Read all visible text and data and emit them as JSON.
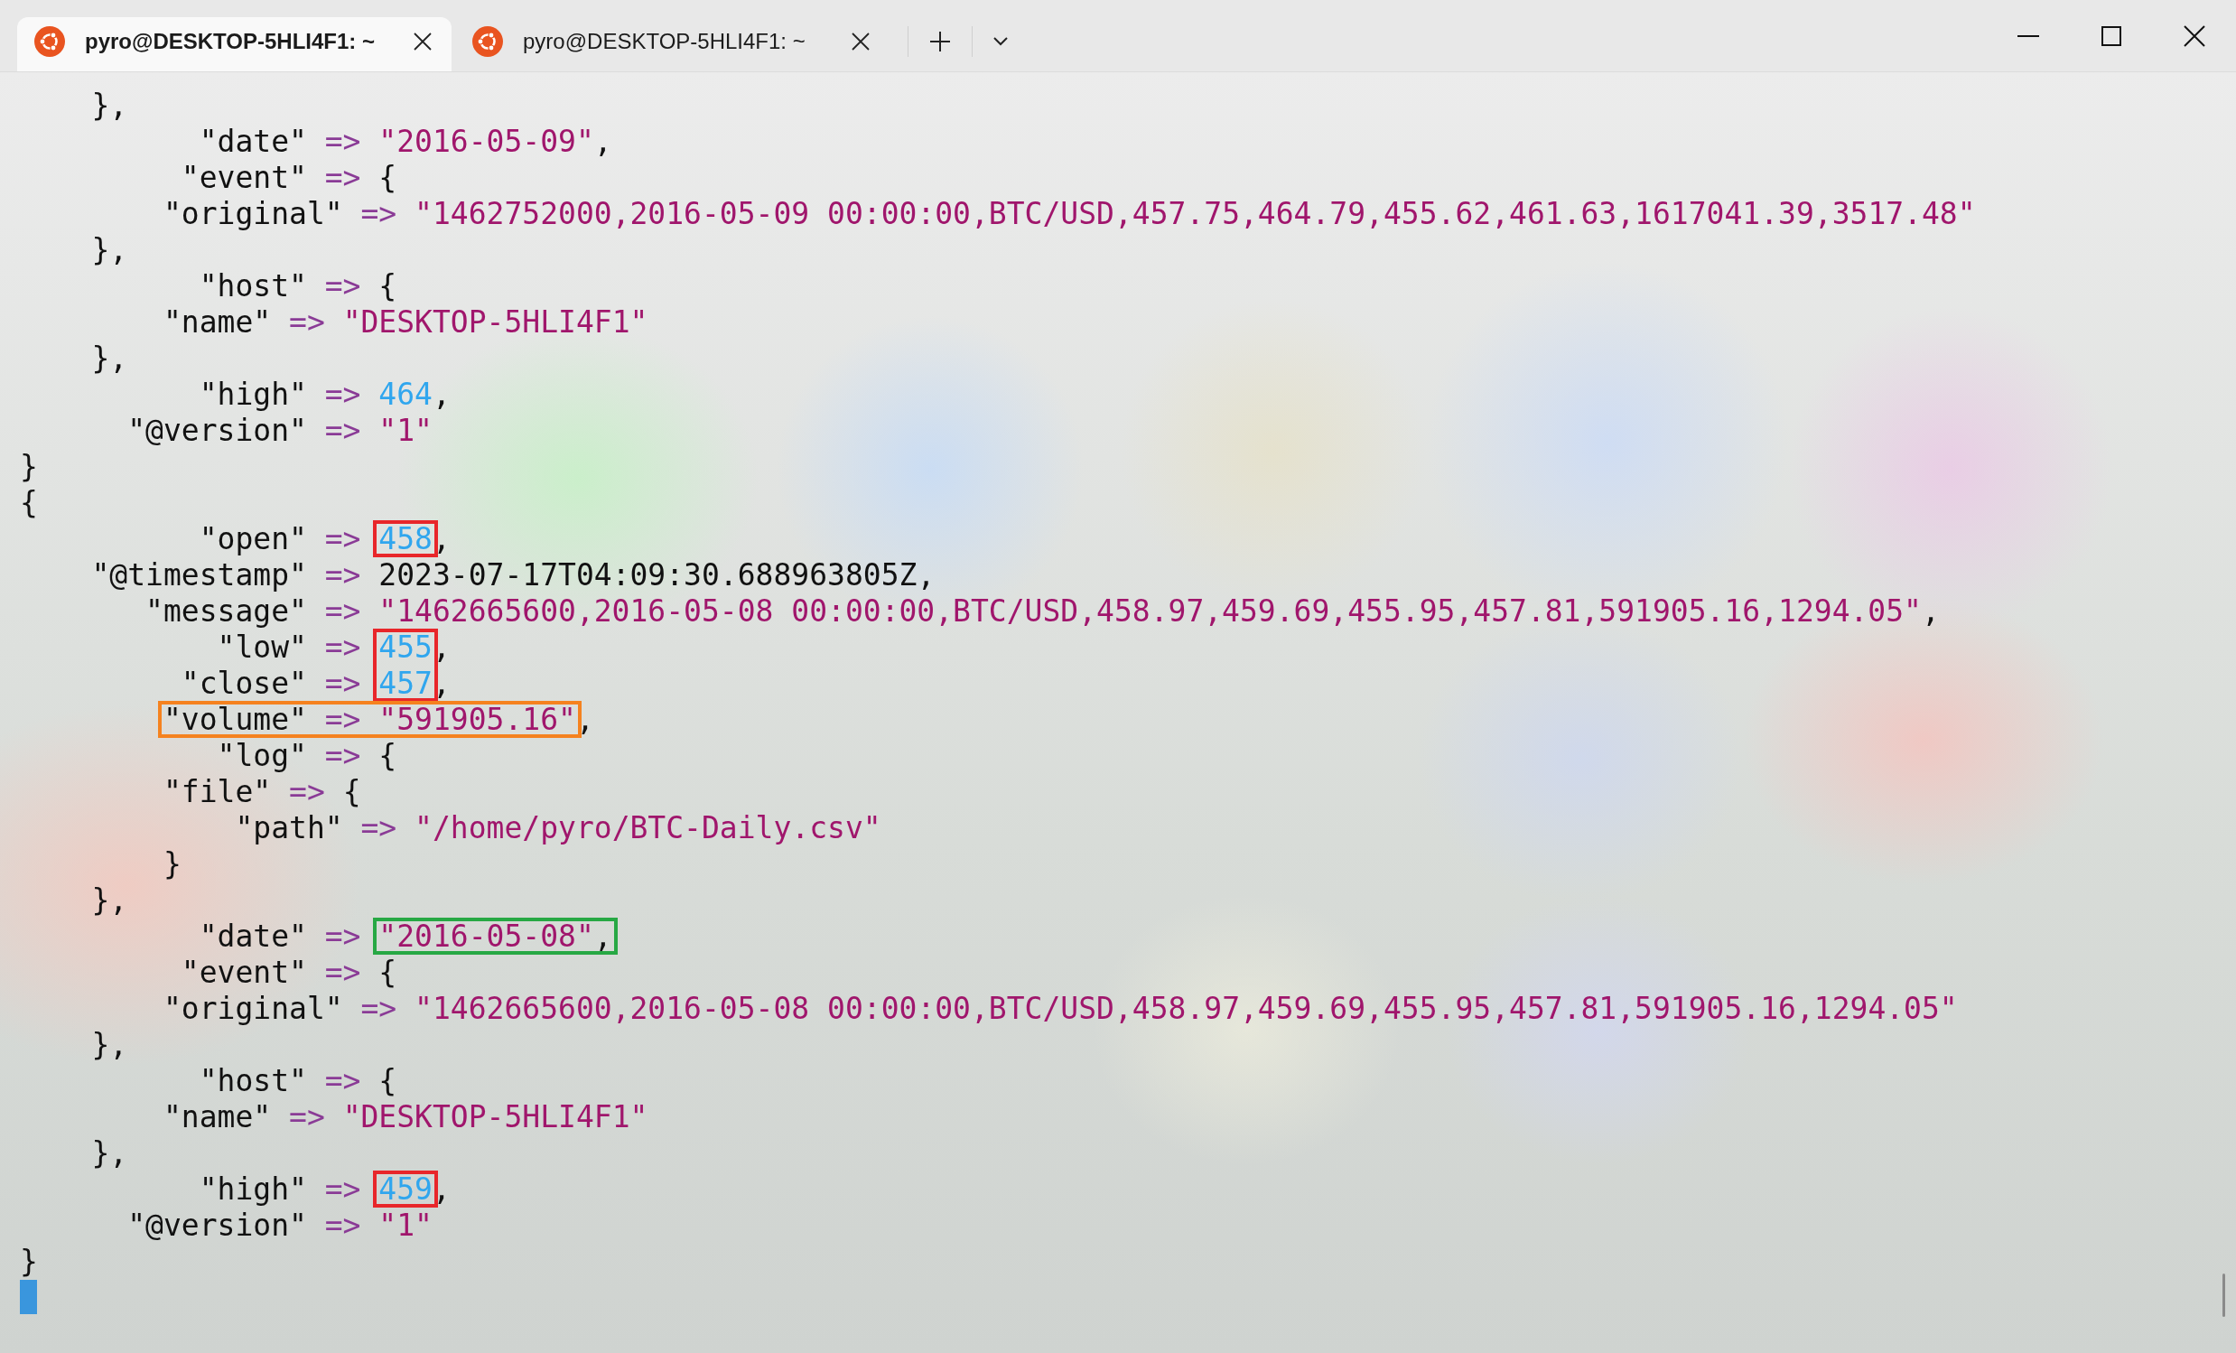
{
  "tabs": [
    {
      "title": "pyro@DESKTOP-5HLI4F1: ~",
      "selected": true
    },
    {
      "title": "pyro@DESKTOP-5HLI4F1: ~",
      "selected": false
    }
  ],
  "terminal": {
    "lines": [
      {
        "tokens": [
          {
            "kind": "plain",
            "text": "},"
          }
        ]
      },
      {
        "tokens": [
          {
            "kind": "key",
            "text": "\"date\""
          },
          {
            "kind": "arrow",
            "text": "=>"
          },
          {
            "kind": "string",
            "text": "\"2016-05-09\""
          },
          {
            "kind": "punct",
            "text": ","
          }
        ]
      },
      {
        "tokens": [
          {
            "kind": "key",
            "text": "\"event\""
          },
          {
            "kind": "arrow",
            "text": "=>"
          },
          {
            "kind": "plain",
            "text": "{"
          }
        ]
      },
      {
        "tokens": [
          {
            "kind": "key",
            "text": "\"original\""
          },
          {
            "kind": "arrow",
            "text": "=>"
          },
          {
            "kind": "string",
            "text": "\"1462752000,2016-05-09 00:00:00,BTC/USD,457.75,464.79,455.62,461.63,1617041.39,3517.48\""
          }
        ]
      },
      {
        "tokens": [
          {
            "kind": "plain",
            "text": "},"
          }
        ]
      },
      {
        "tokens": [
          {
            "kind": "key",
            "text": "\"host\""
          },
          {
            "kind": "arrow",
            "text": "=>"
          },
          {
            "kind": "plain",
            "text": "{"
          }
        ]
      },
      {
        "tokens": [
          {
            "kind": "key",
            "text": "\"name\""
          },
          {
            "kind": "arrow",
            "text": "=>"
          },
          {
            "kind": "string",
            "text": "\"DESKTOP-5HLI4F1\""
          }
        ]
      },
      {
        "tokens": [
          {
            "kind": "plain",
            "text": "},"
          }
        ]
      },
      {
        "tokens": [
          {
            "kind": "key",
            "text": "\"high\""
          },
          {
            "kind": "arrow",
            "text": "=>"
          },
          {
            "kind": "number",
            "text": "464"
          },
          {
            "kind": "punct",
            "text": ","
          }
        ]
      },
      {
        "tokens": [
          {
            "kind": "key",
            "text": "\"@version\""
          },
          {
            "kind": "arrow",
            "text": "=>"
          },
          {
            "kind": "string",
            "text": "\"1\""
          }
        ]
      },
      {
        "tokens": [
          {
            "kind": "plain",
            "text": "}"
          }
        ]
      },
      {
        "tokens": [
          {
            "kind": "plain",
            "text": "{"
          }
        ]
      },
      {
        "tokens": [
          {
            "kind": "key",
            "text": "\"open\""
          },
          {
            "kind": "arrow",
            "text": "=>"
          },
          {
            "kind": "number",
            "text": "458",
            "color": "#e8262a"
          },
          {
            "kind": "punct",
            "text": ","
          }
        ]
      },
      {
        "tokens": [
          {
            "kind": "key",
            "text": "\"@timestamp\""
          },
          {
            "kind": "arrow",
            "text": "=>"
          },
          {
            "kind": "plain",
            "text": "2023-07-17T04:09:30.688963805Z"
          },
          {
            "kind": "punct",
            "text": ","
          }
        ]
      },
      {
        "tokens": [
          {
            "kind": "key",
            "text": "\"message\""
          },
          {
            "kind": "arrow",
            "text": "=>"
          },
          {
            "kind": "string",
            "text": "\"1462665600,2016-05-08 00:00:00,BTC/USD,458.97,459.69,455.95,457.81,591905.16,1294.05\""
          },
          {
            "kind": "punct",
            "text": ","
          }
        ]
      },
      {
        "tokens": [
          {
            "kind": "key",
            "text": "\"low\""
          },
          {
            "kind": "arrow",
            "text": "=>"
          },
          {
            "kind": "number",
            "text": "455",
            "color": "#e8262a"
          },
          {
            "kind": "punct",
            "text": ","
          }
        ]
      },
      {
        "tokens": [
          {
            "kind": "key",
            "text": "\"close\""
          },
          {
            "kind": "arrow",
            "text": "=>"
          },
          {
            "kind": "number",
            "text": "457",
            "color": "#e8262a"
          },
          {
            "kind": "punct",
            "text": ","
          }
        ]
      },
      {
        "tokens": [
          {
            "kind": "key",
            "text": "\"volume\"",
            "color": "#f5821f"
          },
          {
            "kind": "arrow",
            "text": "=>",
            "color": "#f5821f"
          },
          {
            "kind": "string",
            "text": "\"591905.16\"",
            "color": "#f5821f"
          },
          {
            "kind": "punct",
            "text": ","
          }
        ]
      },
      {
        "tokens": [
          {
            "kind": "key",
            "text": "\"log\""
          },
          {
            "kind": "arrow",
            "text": "=>"
          },
          {
            "kind": "plain",
            "text": "{"
          }
        ]
      },
      {
        "tokens": [
          {
            "kind": "key",
            "text": "\"file\""
          },
          {
            "kind": "arrow",
            "text": "=>"
          },
          {
            "kind": "plain",
            "text": "{"
          }
        ]
      },
      {
        "tokens": [
          {
            "kind": "key",
            "text": "\"path\""
          },
          {
            "kind": "arrow",
            "text": "=>"
          },
          {
            "kind": "string",
            "text": "\"/home/pyro/BTC-Daily.csv\""
          }
        ]
      },
      {
        "tokens": [
          {
            "kind": "plain",
            "text": "}"
          }
        ]
      },
      {
        "tokens": [
          {
            "kind": "plain",
            "text": "},"
          }
        ]
      },
      {
        "tokens": [
          {
            "kind": "key",
            "text": "\"date\""
          },
          {
            "kind": "arrow",
            "text": "=>"
          },
          {
            "kind": "string",
            "text": "\"2016-05-08\"",
            "color": "#27a844"
          },
          {
            "kind": "punct",
            "text": ",",
            "color": "#27a844"
          }
        ]
      },
      {
        "tokens": [
          {
            "kind": "key",
            "text": "\"event\""
          },
          {
            "kind": "arrow",
            "text": "=>"
          },
          {
            "kind": "plain",
            "text": "{"
          }
        ]
      },
      {
        "tokens": [
          {
            "kind": "key",
            "text": "\"original\""
          },
          {
            "kind": "arrow",
            "text": "=>"
          },
          {
            "kind": "string",
            "text": "\"1462665600,2016-05-08 00:00:00,BTC/USD,458.97,459.69,455.95,457.81,591905.16,1294.05\""
          }
        ]
      },
      {
        "tokens": [
          {
            "kind": "plain",
            "text": "},"
          }
        ]
      },
      {
        "tokens": [
          {
            "kind": "key",
            "text": "\"host\""
          },
          {
            "kind": "arrow",
            "text": "=>"
          },
          {
            "kind": "plain",
            "text": "{"
          }
        ]
      },
      {
        "tokens": [
          {
            "kind": "key",
            "text": "\"name\""
          },
          {
            "kind": "arrow",
            "text": "=>"
          },
          {
            "kind": "string",
            "text": "\"DESKTOP-5HLI4F1\""
          }
        ]
      },
      {
        "tokens": [
          {
            "kind": "plain",
            "text": "},"
          }
        ]
      },
      {
        "tokens": [
          {
            "kind": "key",
            "text": "\"high\""
          },
          {
            "kind": "arrow",
            "text": "=>"
          },
          {
            "kind": "number",
            "text": "459",
            "color": "#e8262a"
          },
          {
            "kind": "punct",
            "text": ","
          }
        ]
      },
      {
        "tokens": [
          {
            "kind": "key",
            "text": "\"@version\""
          },
          {
            "kind": "arrow",
            "text": "=>"
          },
          {
            "kind": "string",
            "text": "\"1\""
          }
        ]
      },
      {
        "tokens": [
          {
            "kind": "plain",
            "text": "}"
          }
        ]
      }
    ]
  }
}
